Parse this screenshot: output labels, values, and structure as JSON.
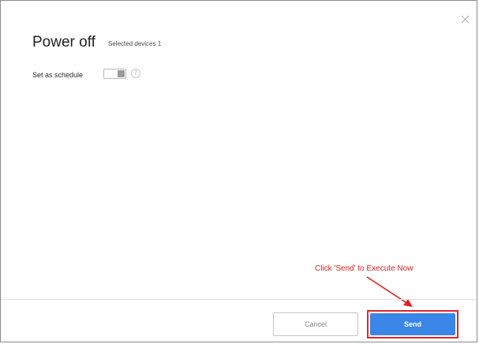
{
  "dialog": {
    "title": "Power off",
    "subtitle": "Selected devices 1",
    "close_icon": "close-icon"
  },
  "schedule": {
    "label": "Set as schedule",
    "toggle_on": false,
    "help_icon": "?"
  },
  "annotation": {
    "text": "Click 'Send' to Execute Now",
    "color": "#e02020"
  },
  "footer": {
    "cancel_label": "Cancel",
    "send_label": "Send"
  },
  "colors": {
    "primary": "#3a86e6",
    "highlight": "#e0262a"
  }
}
